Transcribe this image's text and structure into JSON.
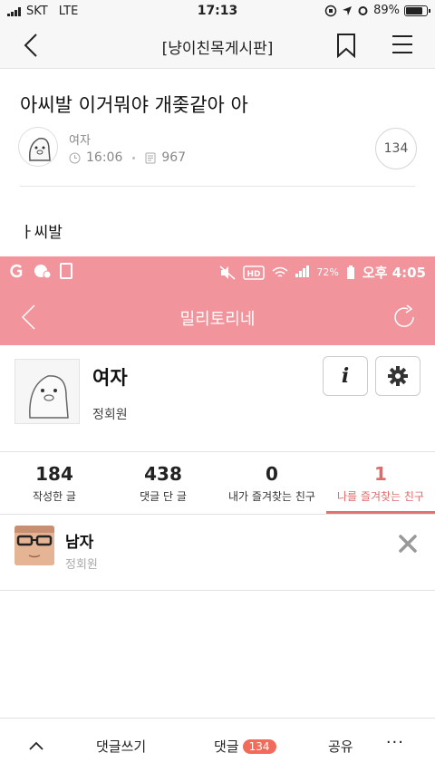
{
  "status_bar": {
    "carrier": "SKT",
    "network": "LTE",
    "time": "17:13",
    "battery": "89%",
    "battery_level": 0.89
  },
  "nav": {
    "title": "[냥이친목게시판]"
  },
  "post": {
    "title": "아씨발 이거뭐야 개좆같아 아",
    "author": "여자",
    "time": "16:06",
    "views": "967",
    "comment_count": "134",
    "body": "ㅏ씨발"
  },
  "embedded": {
    "status_time": "오후 4:05",
    "status_battery": "72%",
    "header_title": "밀리토리네",
    "profile": {
      "name": "여자",
      "subtitle": "정회원",
      "info_label": "i"
    },
    "stats": [
      {
        "value": "184",
        "label": "작성한 글"
      },
      {
        "value": "438",
        "label": "댓글 단 글"
      },
      {
        "value": "0",
        "label": "내가 즐겨찾는 친구"
      },
      {
        "value": "1",
        "label": "나를 즐겨찾는 친구"
      }
    ],
    "friend": {
      "name": "남자",
      "subtitle": "정회원"
    }
  },
  "toolbar": {
    "write_comment": "댓글쓰기",
    "comments": "댓글",
    "comments_badge": "134",
    "share": "공유",
    "more": "···"
  },
  "colors": {
    "embedded_accent": "#f1949b",
    "active_tab": "#e06a6a",
    "badge": "#f26b5a"
  }
}
